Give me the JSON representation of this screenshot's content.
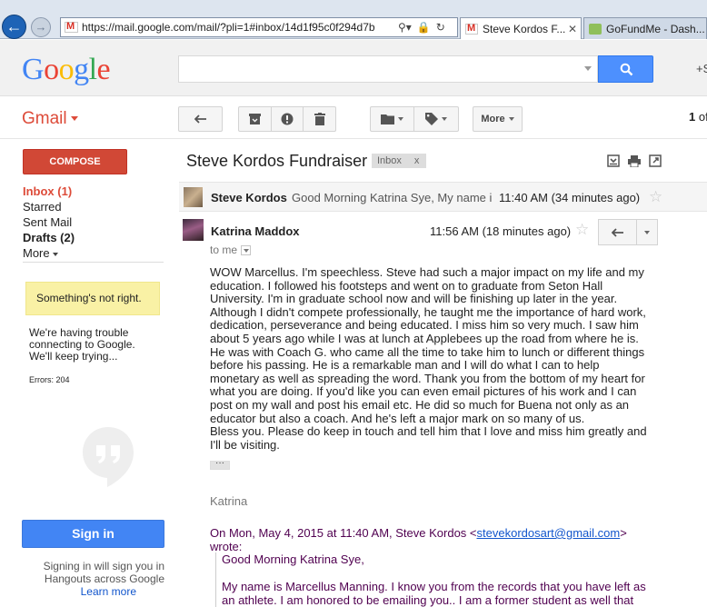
{
  "browser": {
    "url": "https://mail.google.com/mail/?pli=1#inbox/14d1f95c0f294d7b",
    "tabs": [
      {
        "label": "Steve Kordos F..."
      },
      {
        "label": "GoFundMe - Dash..."
      }
    ]
  },
  "header": {
    "logo_letters": [
      "G",
      "o",
      "o",
      "g",
      "l",
      "e"
    ],
    "search_value": "",
    "plus_text": "+S"
  },
  "toolbar": {
    "gmail_label": "Gmail",
    "more_label": "More",
    "count_prefix": "1",
    "count_suffix": "of"
  },
  "nav": {
    "compose_label": "COMPOSE",
    "items": [
      {
        "label": "Inbox (1)"
      },
      {
        "label": "Starred"
      },
      {
        "label": "Sent Mail"
      },
      {
        "label": "Drafts (2)"
      },
      {
        "label": "More"
      }
    ],
    "warning": "Something's not right.",
    "trouble": "We're having trouble connecting to Google. We'll keep trying...",
    "errors": "Errors: 204",
    "signin_label": "Sign in",
    "signin_text_1": "Signing in will sign you in",
    "signin_text_2": "Hangouts across Google",
    "learn_more": "Learn more"
  },
  "conversation": {
    "subject": "Steve Kordos Fundraiser",
    "label_chip": "Inbox",
    "label_chip_x": "x",
    "collapsed": {
      "sender": "Steve Kordos",
      "snippet": "Good Morning Katrina Sye, My name i",
      "time": "11:40 AM (34 minutes ago)"
    },
    "message": {
      "sender": "Katrina Maddox",
      "time": "11:56 AM (18 minutes ago)",
      "to": "to me",
      "body": "WOW Marcellus. I'm speechless. Steve had such a major impact on my life and my education. I followed his footsteps and went on to graduate from Seton Hall University. I'm in graduate school now and will be finishing up later in the year. Although I didn't compete professionally, he taught me the importance of hard work, dedication, perseverance and being educated. I miss him so very much. I saw him about 5 years ago while I was at lunch at Applebees up the road from where he is. He was with Coach G. who came all the time to take him to lunch or different things before his passing. He is a remarkable man and I will do what I can to help monetary as well as spreading the word. Thank you from the bottom of my heart for what you are doing. If you'd like you can even email pictures of his work and I can post on my wall and post his email etc. He did so much for Buena not only as an educator but also a coach. And he's left a major mark on so many of us.",
      "body_2": "Bless you. Please do keep in touch and tell him that I love and miss him greatly and I'll be visiting.",
      "ellipsis": "···",
      "signature": "Katrina",
      "quoted_intro_prefix": "On Mon, May 4, 2015 at 11:40 AM, Steve Kordos <",
      "quoted_email": "stevekordosart@gmail.com",
      "quoted_intro_suffix": "> wrote:",
      "quoted_1": "Good Morning Katrina Sye,",
      "quoted_2": "My name is Marcellus Manning. I know you from the records that you have left as an athlete. I am honored to be emailing you.. I am a former student as well that"
    }
  }
}
